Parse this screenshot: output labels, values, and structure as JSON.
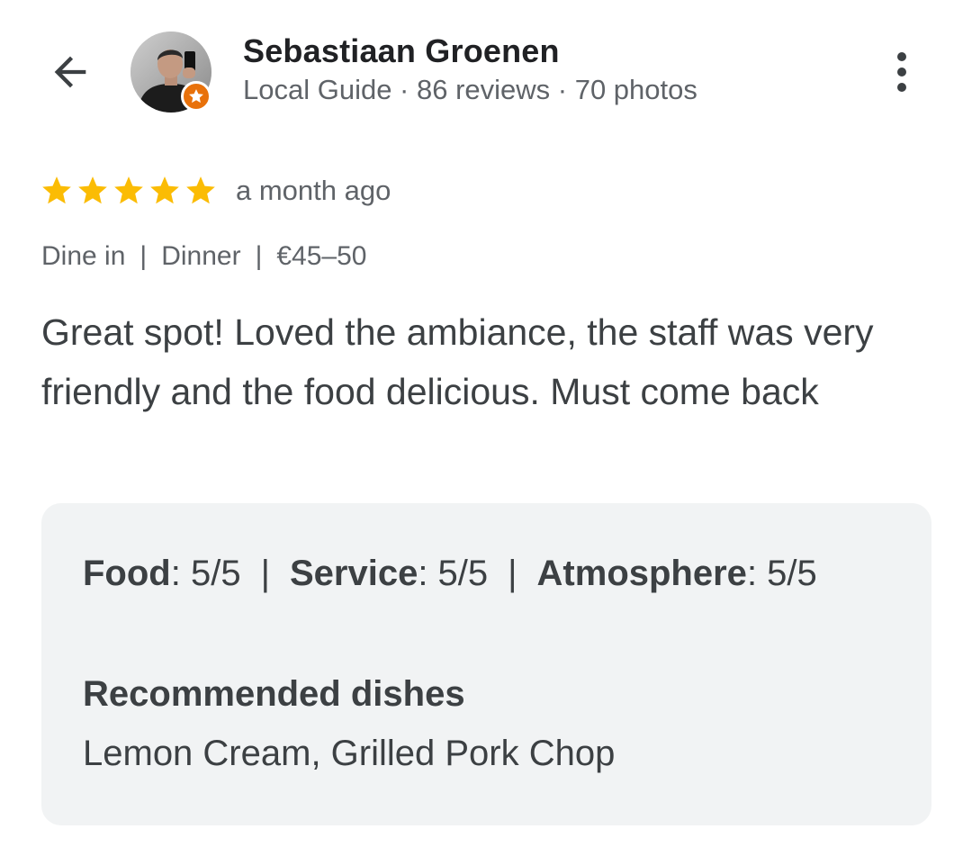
{
  "header": {
    "back_icon": "arrow-back-icon",
    "more_icon": "more-vert-icon",
    "author": {
      "name": "Sebastiaan Groenen",
      "meta": "Local Guide · 86 reviews · 70 photos",
      "badge_icon": "local-guide-star-icon"
    }
  },
  "review": {
    "rating": 5,
    "rating_max": 5,
    "star_color": "#fbbc04",
    "date": "a month ago",
    "attributes": {
      "service_type": "Dine in",
      "meal": "Dinner",
      "price": "€45–50",
      "separator": "|"
    },
    "text": "Great spot! Loved the ambiance, the staff was very friendly and the food delicious. Must come back"
  },
  "details": {
    "ratings": [
      {
        "label": "Food",
        "value": "5/5"
      },
      {
        "label": "Service",
        "value": "5/5"
      },
      {
        "label": "Atmosphere",
        "value": "5/5"
      }
    ],
    "separator": "|",
    "recommended_title": "Recommended dishes",
    "recommended_dishes": "Lemon Cream, Grilled Pork Chop"
  },
  "colors": {
    "badge": "#e8710a",
    "card_background": "#f1f3f4"
  }
}
